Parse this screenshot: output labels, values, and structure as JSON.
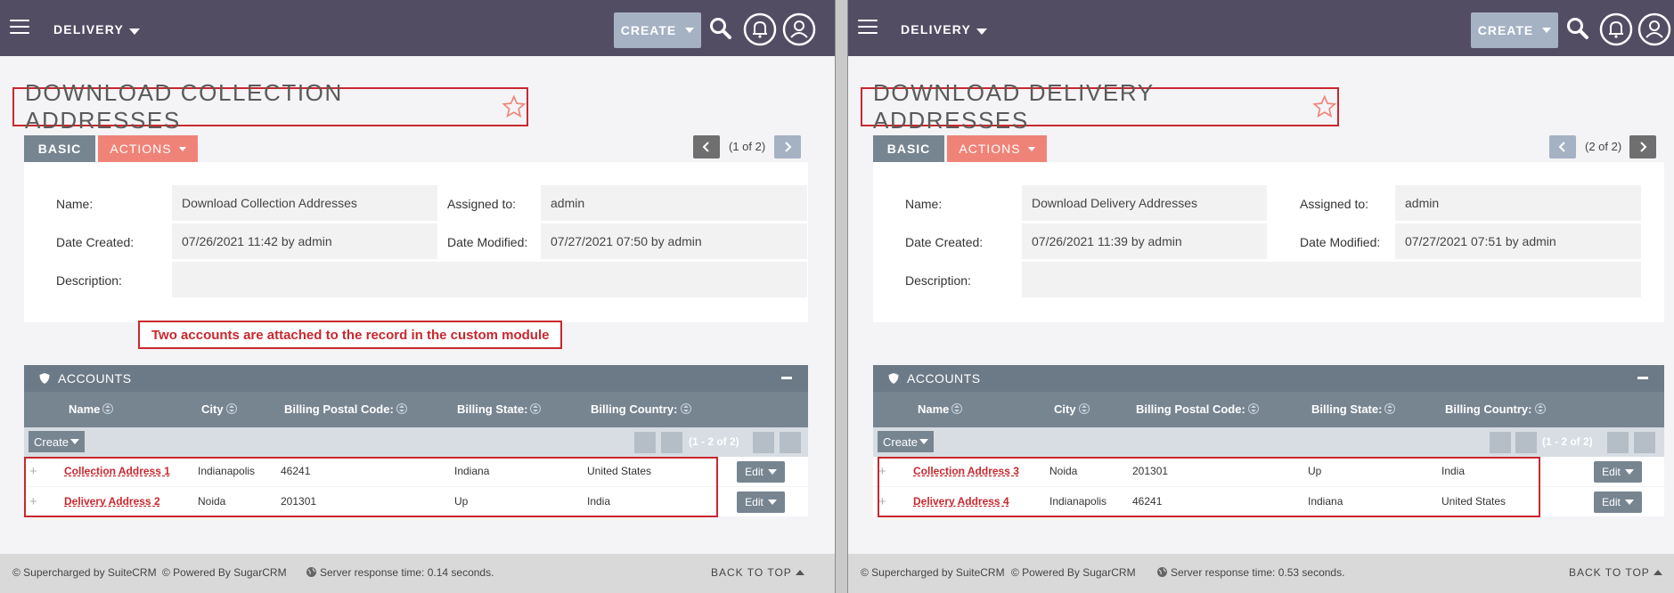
{
  "left": {
    "module_menu": "DELIVERY",
    "create_label": "CREATE",
    "title": "DOWNLOAD COLLECTION ADDRESSES",
    "tab_basic": "BASIC",
    "tab_actions": "ACTIONS",
    "pager_text": "(1 of 2)",
    "fields": {
      "name_label": "Name:",
      "name_value": "Download Collection Addresses",
      "assigned_label": "Assigned to:",
      "assigned_value": "admin",
      "date_created_label": "Date Created:",
      "date_created_value": "07/26/2021 11:42 by admin",
      "date_modified_label": "Date Modified:",
      "date_modified_value": "07/27/2021 07:50 by admin",
      "description_label": "Description:",
      "description_value": ""
    },
    "annotation": "Two accounts are attached to the record in the custom module",
    "subpanel": {
      "title": "ACCOUNTS",
      "columns": [
        "Name",
        "City",
        "Billing Postal Code:",
        "Billing State:",
        "Billing Country:"
      ],
      "create_label": "Create",
      "count": "(1 - 2 of 2)",
      "rows": [
        {
          "name": "Collection Address 1",
          "city": "Indianapolis",
          "postal": "46241",
          "state": "Indiana",
          "country": "United States",
          "edit": "Edit"
        },
        {
          "name": "Delivery Address 2",
          "city": "Noida",
          "postal": "201301",
          "state": "Up",
          "country": "India",
          "edit": "Edit"
        }
      ]
    },
    "footer": {
      "suitecrm": "© Supercharged by SuiteCRM",
      "sugarcrm": "© Powered By SugarCRM",
      "response": "Server response time: 0.14 seconds.",
      "back_to_top": "BACK TO TOP"
    }
  },
  "right": {
    "module_menu": "DELIVERY",
    "create_label": "CREATE",
    "title": "DOWNLOAD DELIVERY ADDRESSES",
    "tab_basic": "BASIC",
    "tab_actions": "ACTIONS",
    "pager_text": "(2 of 2)",
    "fields": {
      "name_label": "Name:",
      "name_value": "Download Delivery Addresses",
      "assigned_label": "Assigned to:",
      "assigned_value": "admin",
      "date_created_label": "Date Created:",
      "date_created_value": "07/26/2021 11:39 by admin",
      "date_modified_label": "Date Modified:",
      "date_modified_value": "07/27/2021 07:51 by admin",
      "description_label": "Description:",
      "description_value": ""
    },
    "subpanel": {
      "title": "ACCOUNTS",
      "columns": [
        "Name",
        "City",
        "Billing Postal Code:",
        "Billing State:",
        "Billing Country:"
      ],
      "create_label": "Create",
      "count": "(1 - 2 of 2)",
      "rows": [
        {
          "name": "Collection Address 3",
          "city": "Noida",
          "postal": "201301",
          "state": "Up",
          "country": "India",
          "edit": "Edit"
        },
        {
          "name": "Delivery Address 4",
          "city": "Indianapolis",
          "postal": "46241",
          "state": "Indiana",
          "country": "United States",
          "edit": "Edit"
        }
      ]
    },
    "footer": {
      "suitecrm": "© Supercharged by SuiteCRM",
      "sugarcrm": "© Powered By SugarCRM",
      "response": "Server response time: 0.53 seconds.",
      "back_to_top": "BACK TO TOP"
    }
  },
  "icons": {
    "menu": "hamburger-menu-icon",
    "search": "search-icon",
    "notifications": "bell-icon",
    "profile": "user-icon",
    "favorite": "star-icon",
    "subpanel": "shield-icon",
    "sort": "sort-icon",
    "globe": "globe-icon"
  },
  "colors": {
    "topbar": "#534d64",
    "accent_red": "#c8282f",
    "actions": "#f08377",
    "basic_tab": "#778591"
  }
}
